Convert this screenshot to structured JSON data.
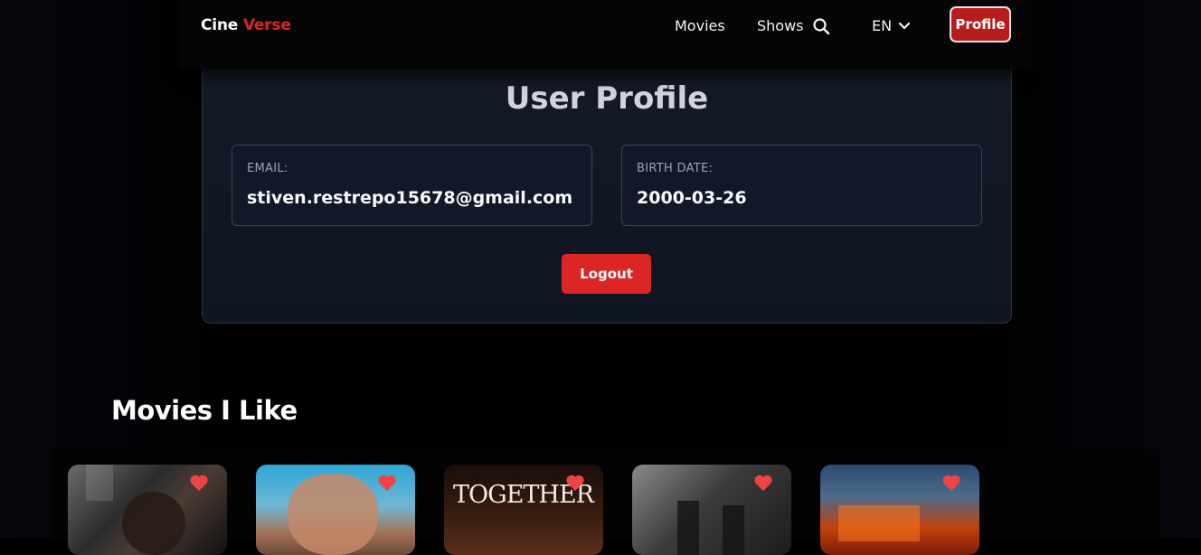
{
  "nav": {
    "brand_part1": "Cine",
    "brand_part2": "Verse",
    "links": [
      "Movies",
      "Shows"
    ],
    "language": "EN",
    "profile_label": "Profile"
  },
  "profile": {
    "title": "User Profile",
    "email_label": "EMAIL:",
    "email_value": "stiven.restrepo15678@gmail.com",
    "birth_label": "BIRTH DATE:",
    "birth_value": "2000-03-26",
    "logout_label": "Logout"
  },
  "liked": {
    "title": "Movies I Like",
    "posters": [
      {
        "text": ""
      },
      {
        "text": ""
      },
      {
        "text": "TOGETHER"
      },
      {
        "text": ""
      },
      {
        "text": ""
      }
    ]
  },
  "colors": {
    "accent": "#dc2626",
    "heart": "#ef4444",
    "card_bg": "#141a27"
  },
  "icons": [
    "search-icon",
    "chevron-down-icon",
    "heart-icon"
  ]
}
